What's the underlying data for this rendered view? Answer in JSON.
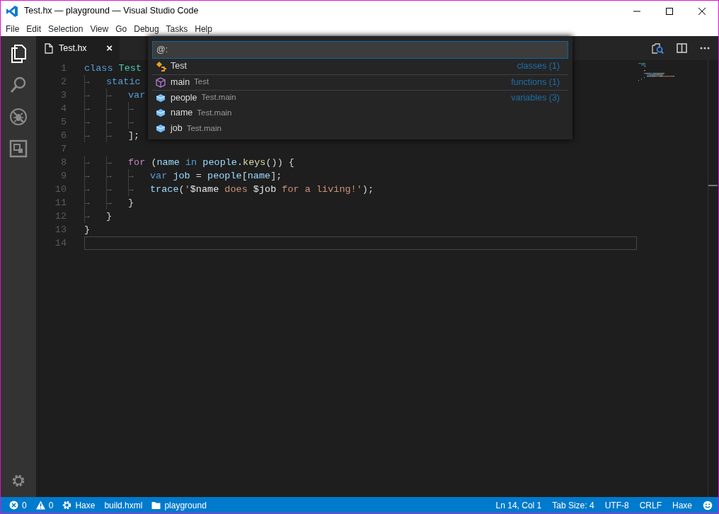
{
  "window": {
    "title": "Test.hx — playground — Visual Studio Code"
  },
  "menu": [
    "File",
    "Edit",
    "Selection",
    "View",
    "Go",
    "Debug",
    "Tasks",
    "Help"
  ],
  "activity_bar": [
    {
      "kind": "files",
      "selected": true
    },
    {
      "kind": "search",
      "selected": false
    },
    {
      "kind": "debug",
      "selected": false
    },
    {
      "kind": "extensions",
      "selected": false
    }
  ],
  "tabs": [
    {
      "label": "Test.hx",
      "close": "×",
      "selected": true
    }
  ],
  "editor": {
    "lines": [
      {
        "number": "1",
        "current": false,
        "tokens": [
          {
            "kind": "kw",
            "text": "class "
          },
          {
            "kind": "type",
            "text": "Test"
          }
        ]
      },
      {
        "number": "2",
        "current": false,
        "tokens": [
          {
            "kind": "tab",
            "text": "→"
          },
          {
            "kind": "kw",
            "text": "static"
          }
        ]
      },
      {
        "number": "3",
        "current": false,
        "tokens": [
          {
            "kind": "tab",
            "text": "→"
          },
          {
            "kind": "tab",
            "text": "→"
          },
          {
            "kind": "kw",
            "text": "var"
          }
        ]
      },
      {
        "number": "4",
        "current": false,
        "tokens": [
          {
            "kind": "tab",
            "text": "→"
          },
          {
            "kind": "tab",
            "text": "→"
          },
          {
            "kind": "tab",
            "text": "→"
          }
        ]
      },
      {
        "number": "5",
        "current": false,
        "tokens": [
          {
            "kind": "tab",
            "text": "→"
          },
          {
            "kind": "tab",
            "text": "→"
          },
          {
            "kind": "tab",
            "text": "→"
          }
        ]
      },
      {
        "number": "6",
        "current": false,
        "tokens": [
          {
            "kind": "tab",
            "text": "→"
          },
          {
            "kind": "tab",
            "text": "→"
          },
          {
            "kind": "punct",
            "text": "];"
          }
        ]
      },
      {
        "number": "7",
        "current": false
      },
      {
        "number": "8",
        "current": false,
        "tokens": [
          {
            "kind": "tab",
            "text": "→"
          },
          {
            "kind": "tab",
            "text": "→"
          },
          {
            "kind": "ctrl",
            "text": "for"
          },
          {
            "kind": "punct",
            "text": " ("
          },
          {
            "kind": "var",
            "text": "name"
          },
          {
            "kind": "kw",
            "text": " in "
          },
          {
            "kind": "var",
            "text": "people"
          },
          {
            "kind": "punct",
            "text": "."
          },
          {
            "kind": "fn",
            "text": "keys"
          },
          {
            "kind": "punct",
            "text": "()) {"
          }
        ]
      },
      {
        "number": "9",
        "current": false,
        "tokens": [
          {
            "kind": "tab",
            "text": "→"
          },
          {
            "kind": "tab",
            "text": "→"
          },
          {
            "kind": "tab",
            "text": "→"
          },
          {
            "kind": "kw",
            "text": "var "
          },
          {
            "kind": "var",
            "text": "job"
          },
          {
            "kind": "punct",
            "text": " = "
          },
          {
            "kind": "var",
            "text": "people"
          },
          {
            "kind": "punct",
            "text": "["
          },
          {
            "kind": "var",
            "text": "name"
          },
          {
            "kind": "punct",
            "text": "];"
          }
        ]
      },
      {
        "number": "10",
        "current": false,
        "tokens": [
          {
            "kind": "tab",
            "text": "→"
          },
          {
            "kind": "tab",
            "text": "→"
          },
          {
            "kind": "tab",
            "text": "→"
          },
          {
            "kind": "var",
            "text": "trace"
          },
          {
            "kind": "punct",
            "text": "("
          },
          {
            "kind": "str",
            "text": "'"
          },
          {
            "kind": "interp",
            "text": "$name"
          },
          {
            "kind": "str",
            "text": " does "
          },
          {
            "kind": "interp",
            "text": "$job"
          },
          {
            "kind": "str",
            "text": " for a living!'"
          },
          {
            "kind": "punct",
            "text": ");"
          }
        ]
      },
      {
        "number": "11",
        "current": false,
        "tokens": [
          {
            "kind": "tab",
            "text": "→"
          },
          {
            "kind": "tab",
            "text": "→"
          },
          {
            "kind": "punct",
            "text": "}"
          }
        ]
      },
      {
        "number": "12",
        "current": false,
        "tokens": [
          {
            "kind": "tab",
            "text": "→"
          },
          {
            "kind": "punct",
            "text": "}"
          }
        ]
      },
      {
        "number": "13",
        "current": false,
        "tokens": [
          {
            "kind": "punct",
            "text": "}"
          }
        ]
      },
      {
        "number": "14",
        "current": true
      }
    ]
  },
  "quick_open": {
    "value": "@:",
    "items": [
      {
        "kind": "class",
        "label": "Test",
        "category": "classes (1)",
        "separator": false
      },
      {
        "kind": "function",
        "label": "main",
        "detail": "Test",
        "category": "functions (1)",
        "separator": true
      },
      {
        "kind": "variable",
        "label": "people",
        "detail": "Test.main",
        "category": "variables (3)",
        "separator": true
      },
      {
        "kind": "variable",
        "label": "name",
        "detail": "Test.main",
        "separator": false
      },
      {
        "kind": "variable",
        "label": "job",
        "detail": "Test.main",
        "separator": false
      }
    ]
  },
  "status_bar": {
    "left": [
      {
        "kind": "errors",
        "text": "0"
      },
      {
        "kind": "warnings",
        "text": "0"
      },
      {
        "kind": "gear",
        "text": "Haxe"
      },
      {
        "kind": "plain",
        "text": "build.hxml"
      },
      {
        "kind": "folder",
        "text": "playground"
      }
    ],
    "right": [
      {
        "kind": "plain",
        "text": "Ln 14, Col 1"
      },
      {
        "kind": "plain",
        "text": "Tab Size: 4"
      },
      {
        "kind": "plain",
        "text": "UTF-8"
      },
      {
        "kind": "plain",
        "text": "CRLF"
      },
      {
        "kind": "plain",
        "text": "Haxe"
      },
      {
        "kind": "smiley"
      }
    ]
  }
}
